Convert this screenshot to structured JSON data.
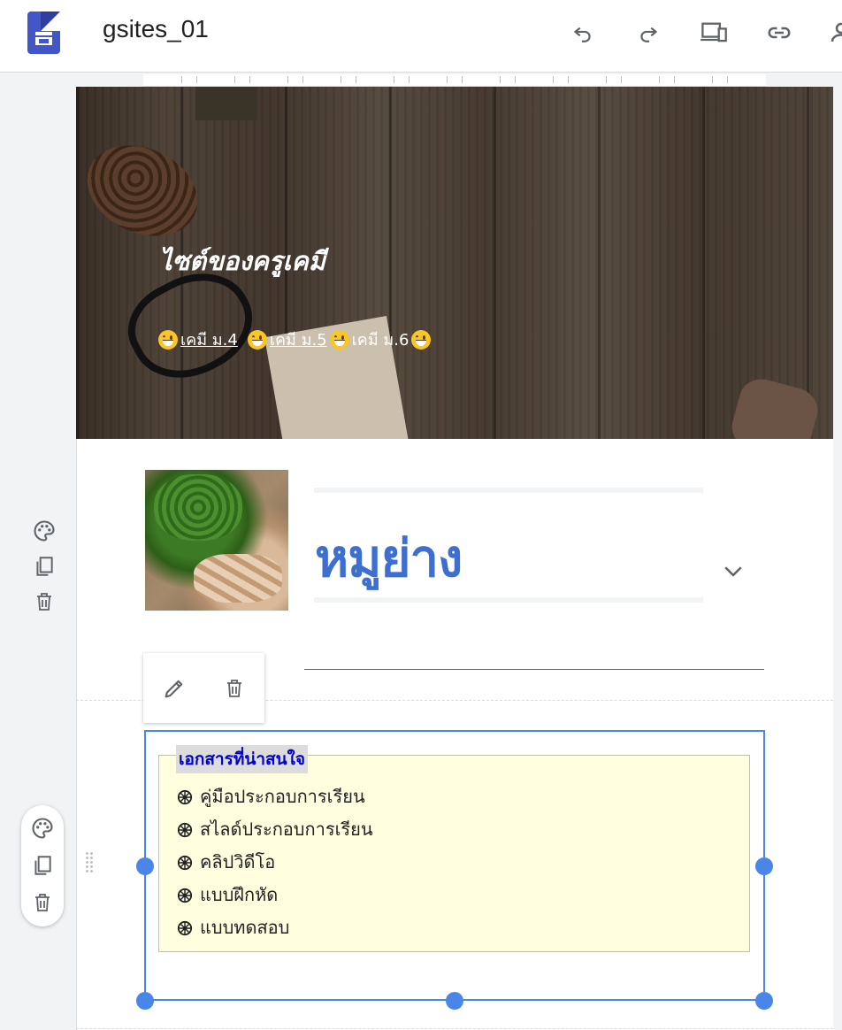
{
  "toolbar": {
    "doc_title": "gsites_01",
    "icons": [
      "undo-icon",
      "redo-icon",
      "preview-devices-icon",
      "link-icon",
      "share-person-icon"
    ]
  },
  "header": {
    "site_title": "ไซต์ของครูเคมี",
    "nav": [
      {
        "label": "เคมี ม.4",
        "linked": true
      },
      {
        "label": "เคมี ม.5",
        "linked": true
      },
      {
        "label": "เคมี ม.6",
        "linked": false
      }
    ],
    "emoji": "grinning-face"
  },
  "section1": {
    "heading": "หมูย่าง",
    "image": "kale-and-grilled-pork-photo"
  },
  "textbox": {
    "heading": "เอกสารที่น่าสนใจ",
    "items": [
      "คู่มือประกอบการเรียน",
      "สไลด์ประกอบการเรียน",
      "คลิปวิดีโอ",
      "แบบฝึกหัด",
      "แบบทดสอบ"
    ],
    "bullet_icon": "wheel-of-dharma-icon"
  },
  "colors": {
    "heading_blue": "#3d6fd1",
    "selection_blue": "#4a86e8",
    "note_bg": "#ffffe0",
    "note_heading": "#0000cc"
  }
}
